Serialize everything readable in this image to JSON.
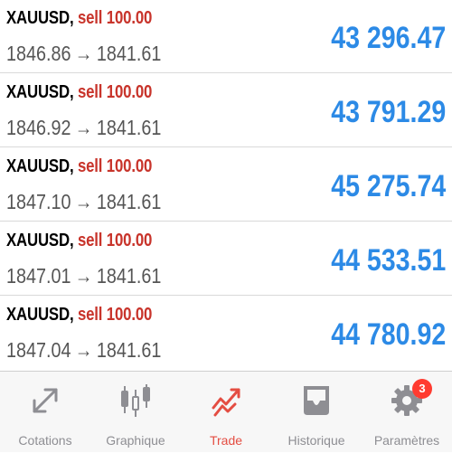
{
  "colors": {
    "symbol": "#000000",
    "sell": "#c8342b",
    "price": "#555555",
    "profit": "#2c8ae6",
    "tab_inactive": "#8e8e93",
    "tab_active": "#e44d42",
    "badge": "#ff3b30"
  },
  "trades": [
    {
      "symbol": "XAUUSD",
      "sep": ",",
      "side": "sell 100.00",
      "open_price": "1846.86",
      "arrow": "→",
      "current_price": "1841.61",
      "profit": "43 296.47"
    },
    {
      "symbol": "XAUUSD",
      "sep": ",",
      "side": "sell 100.00",
      "open_price": "1846.92",
      "arrow": "→",
      "current_price": "1841.61",
      "profit": "43 791.29"
    },
    {
      "symbol": "XAUUSD",
      "sep": ",",
      "side": "sell 100.00",
      "open_price": "1847.10",
      "arrow": "→",
      "current_price": "1841.61",
      "profit": "45 275.74"
    },
    {
      "symbol": "XAUUSD",
      "sep": ",",
      "side": "sell 100.00",
      "open_price": "1847.01",
      "arrow": "→",
      "current_price": "1841.61",
      "profit": "44 533.51"
    },
    {
      "symbol": "XAUUSD",
      "sep": ",",
      "side": "sell 100.00",
      "open_price": "1847.04",
      "arrow": "→",
      "current_price": "1841.61",
      "profit": "44 780.92"
    }
  ],
  "tabbar": {
    "tabs": [
      {
        "label": "Cotations",
        "icon": "quotes-arrows-icon",
        "active": false
      },
      {
        "label": "Graphique",
        "icon": "candlestick-chart-icon",
        "active": false
      },
      {
        "label": "Trade",
        "icon": "trade-trend-icon",
        "active": true
      },
      {
        "label": "Historique",
        "icon": "history-inbox-icon",
        "active": false
      },
      {
        "label": "Paramètres",
        "icon": "gear-icon",
        "active": false,
        "badge": "3"
      }
    ]
  }
}
